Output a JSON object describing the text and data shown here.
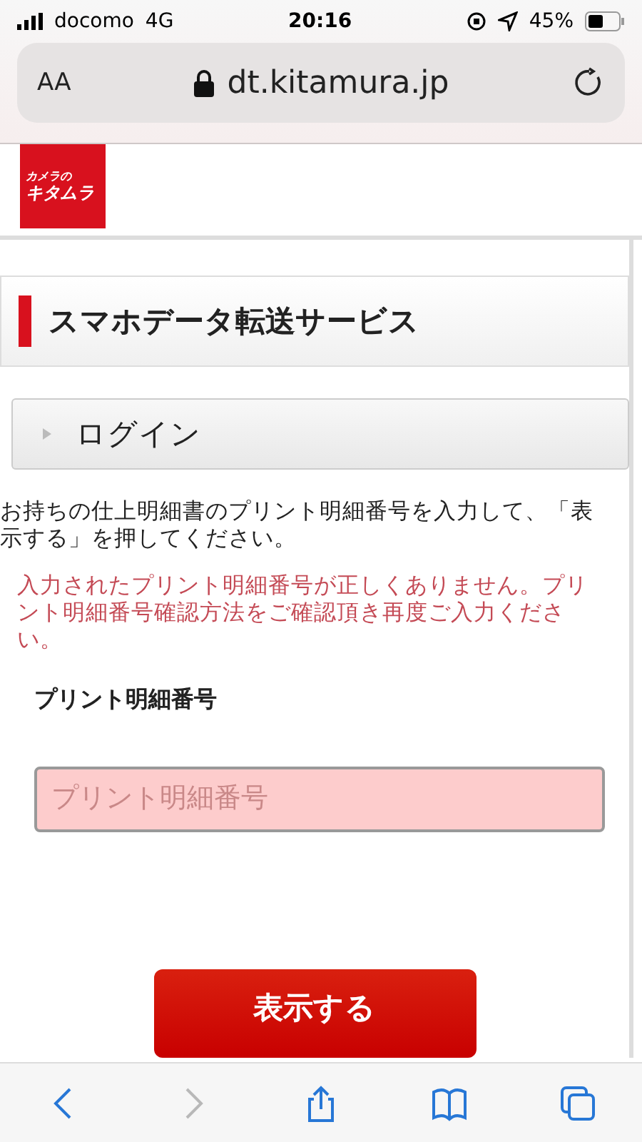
{
  "status_bar": {
    "carrier": "docomo",
    "network": "4G",
    "time": "20:16",
    "battery": "45%"
  },
  "address_bar": {
    "text_size": "AA",
    "url": "dt.kitamura.jp"
  },
  "logo": {
    "lines": [
      "カメラの",
      "キタムラ"
    ]
  },
  "page_title": "スマホデータ転送サービス",
  "login_bar": {
    "label": "ログイン"
  },
  "instructions": "お持ちの仕上明細書のプリント明細番号を入力して、「表示する」を押してください。",
  "error_message": "入力されたプリント明細番号が正しくありません。プリント明細番号確認方法をご確認頂き再度ご入力ください。",
  "field": {
    "label": "プリント明細番号",
    "placeholder": "プリント明細番号",
    "invalid": true
  },
  "submit_button": "表示する",
  "toolbar": [
    {
      "kind": "back",
      "disabled": false
    },
    {
      "kind": "forward",
      "disabled": true
    },
    {
      "kind": "share",
      "disabled": false
    },
    {
      "kind": "bookmarks",
      "disabled": false
    },
    {
      "kind": "tabs",
      "disabled": false
    }
  ]
}
